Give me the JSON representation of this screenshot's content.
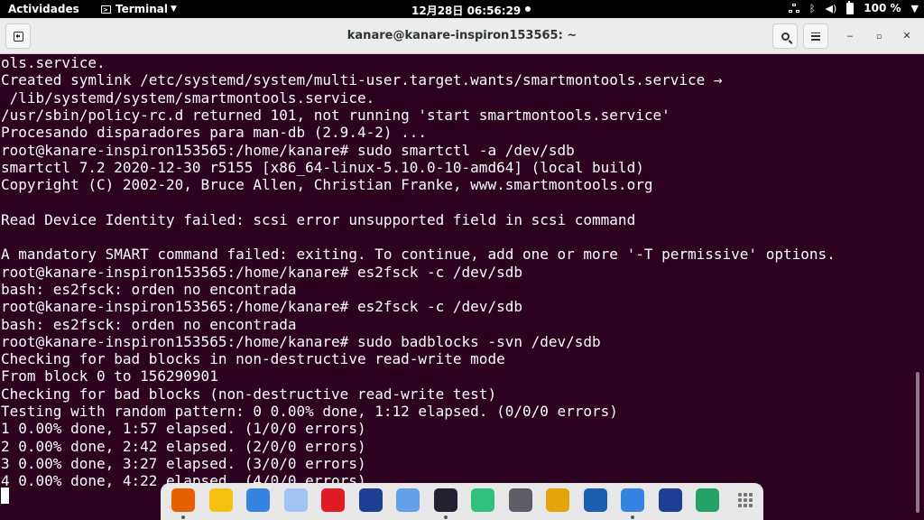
{
  "topbar": {
    "activities": "Actividades",
    "app_menu": "Terminal",
    "clock": "12月28日  06:56:29",
    "battery": "100 %"
  },
  "window": {
    "title": "kanare@kanare-inspiron153565: ~"
  },
  "terminal": {
    "lines": [
      "ols.service.",
      "Created symlink /etc/systemd/system/multi-user.target.wants/smartmontools.service →",
      " /lib/systemd/system/smartmontools.service.",
      "/usr/sbin/policy-rc.d returned 101, not running 'start smartmontools.service'",
      "Procesando disparadores para man-db (2.9.4-2) ...",
      "root@kanare-inspiron153565:/home/kanare# sudo smartctl -a /dev/sdb",
      "smartctl 7.2 2020-12-30 r5155 [x86_64-linux-5.10.0-10-amd64] (local build)",
      "Copyright (C) 2002-20, Bruce Allen, Christian Franke, www.smartmontools.org",
      "",
      "Read Device Identity failed: scsi error unsupported field in scsi command",
      "",
      "A mandatory SMART command failed: exiting. To continue, add one or more '-T permissive' options.",
      "root@kanare-inspiron153565:/home/kanare# es2fsck -c /dev/sdb",
      "bash: es2fsck: orden no encontrada",
      "root@kanare-inspiron153565:/home/kanare# es2fsck -c /dev/sdb",
      "bash: es2fsck: orden no encontrada",
      "root@kanare-inspiron153565:/home/kanare# sudo badblocks -svn /dev/sdb",
      "Checking for bad blocks in non-destructive read-write mode",
      "From block 0 to 156290901",
      "Checking for bad blocks (non-destructive read-write test)",
      "Testing with random pattern: 0 0.00% done, 1:12 elapsed. (0/0/0 errors)",
      "1 0.00% done, 1:57 elapsed. (1/0/0 errors)",
      "2 0.00% done, 2:42 elapsed. (2/0/0 errors)",
      "3 0.00% done, 3:27 elapsed. (3/0/0 errors)",
      "4 0.00% done, 4:22 elapsed. (4/0/0 errors)"
    ]
  },
  "dock": {
    "apps": [
      {
        "name": "firefox-icon",
        "color": "#e66000",
        "running": true
      },
      {
        "name": "rhythmbox-icon",
        "color": "#f5c211",
        "running": false
      },
      {
        "name": "libreoffice-writer-icon",
        "color": "#3584e4",
        "running": false
      },
      {
        "name": "software-icon",
        "color": "#9fc5f0",
        "running": false
      },
      {
        "name": "help-icon",
        "color": "#e01b24",
        "running": false
      },
      {
        "name": "vpn-shield-icon",
        "color": "#1c3f94",
        "running": false
      },
      {
        "name": "app-store-icon",
        "color": "#62a0ea",
        "running": false
      },
      {
        "name": "terminal-icon",
        "color": "#241f31",
        "running": true
      },
      {
        "name": "screenshot-icon",
        "color": "#2ec27e",
        "running": false
      },
      {
        "name": "search-tool-icon",
        "color": "#5e5c64",
        "running": false
      },
      {
        "name": "disk-cleaner-icon",
        "color": "#e5a50a",
        "running": false
      },
      {
        "name": "thunderbird-icon",
        "color": "#1a5fb4",
        "running": false
      },
      {
        "name": "arch-app-icon",
        "color": "#3584e4",
        "running": true
      },
      {
        "name": "shield-app-icon",
        "color": "#1c3f94",
        "running": false
      },
      {
        "name": "trash-icon",
        "color": "#26a269",
        "running": false
      }
    ]
  }
}
